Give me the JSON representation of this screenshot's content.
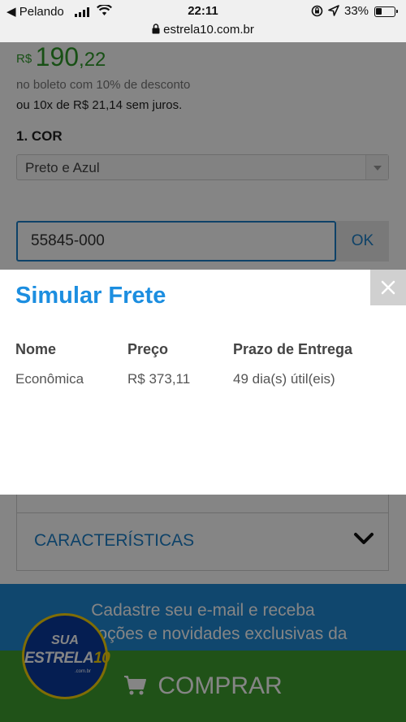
{
  "status_bar": {
    "carrier": "Pelando",
    "time": "22:11",
    "battery": "33%",
    "url": "estrela10.com.br"
  },
  "product": {
    "currency": "R$",
    "price_int": "190",
    "price_dec": ",22",
    "boleto_text": "no boleto com 10% de desconto",
    "installments_text": "ou 10x de R$ 21,14 sem juros.",
    "color_title": "1. COR",
    "color_selected": "Preto e Azul"
  },
  "shipping": {
    "cep_value": "55845-000",
    "ok_label": "OK"
  },
  "modal": {
    "title": "Simular Frete",
    "close_label": "×",
    "headers": [
      "Nome",
      "Preço",
      "Prazo de Entrega"
    ],
    "rows": [
      [
        "Econômica",
        "R$ 373,11",
        "49 dia(s) útil(eis)"
      ]
    ]
  },
  "accordion": {
    "label": "CARACTERÍSTICAS"
  },
  "newsletter": {
    "line1": "Cadastre seu e-mail e receba",
    "line2": "promoções e novidades exclusivas da"
  },
  "logo": {
    "sua": "SUA",
    "estrela": "ESTRELA",
    "ten": "10",
    "domain": ".com.br"
  },
  "buy": {
    "label": "COMPRAR"
  },
  "colors": {
    "brand_blue": "#1c7fc7",
    "price_green": "#2e9a2a",
    "buy_green": "#3f9e2e",
    "newsletter_blue": "#1f88d3"
  }
}
